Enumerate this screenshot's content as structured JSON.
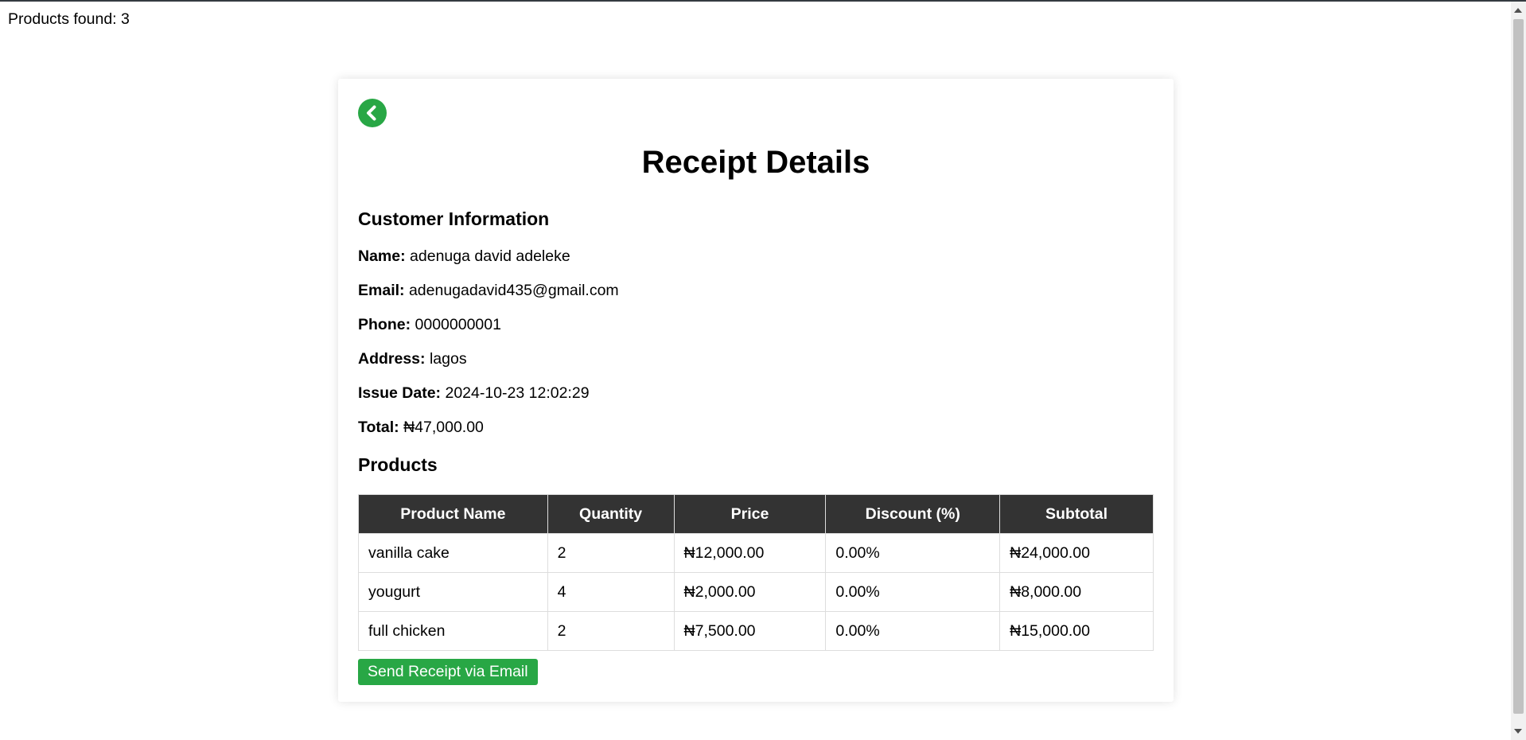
{
  "products_found": "Products found: 3",
  "page_title": "Receipt Details",
  "customer_section_title": "Customer Information",
  "customer": {
    "name_label": "Name:",
    "name": "adenuga david adeleke",
    "email_label": "Email:",
    "email": "adenugadavid435@gmail.com",
    "phone_label": "Phone:",
    "phone": "0000000001",
    "address_label": "Address:",
    "address": "lagos",
    "issue_date_label": "Issue Date:",
    "issue_date": "2024-10-23 12:02:29",
    "total_label": "Total:",
    "total": "₦47,000.00"
  },
  "products_section_title": "Products",
  "table": {
    "headers": [
      "Product Name",
      "Quantity",
      "Price",
      "Discount (%)",
      "Subtotal"
    ],
    "rows": [
      [
        "vanilla cake",
        "2",
        "₦12,000.00",
        "0.00%",
        "₦24,000.00"
      ],
      [
        "yougurt",
        "4",
        "₦2,000.00",
        "0.00%",
        "₦8,000.00"
      ],
      [
        "full chicken",
        "2",
        "₦7,500.00",
        "0.00%",
        "₦15,000.00"
      ]
    ]
  },
  "send_button_label": "Send Receipt via Email",
  "icons": {
    "back": "chevron-left-circle-icon"
  },
  "colors": {
    "accent": "#28a745",
    "table_header_bg": "#333333",
    "topbar": "#343a40"
  }
}
